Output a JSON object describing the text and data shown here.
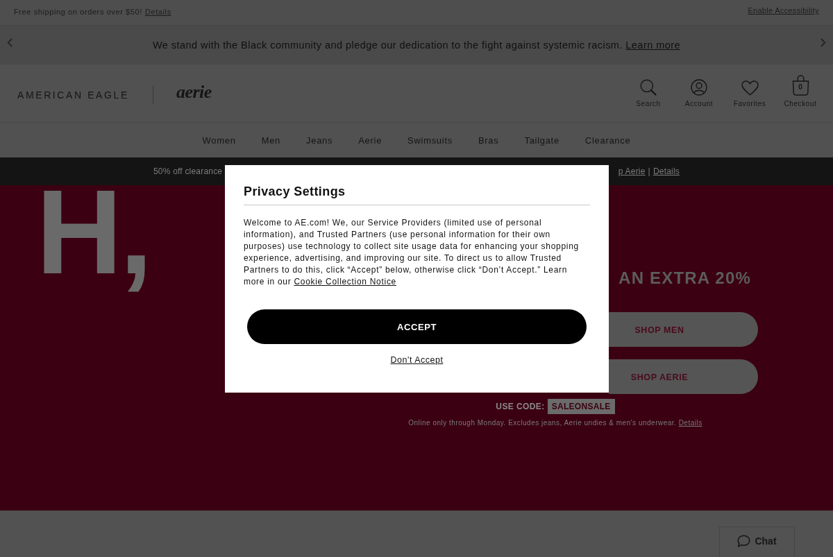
{
  "top_bar": {
    "shipping_text": "Free shipping on orders over $50!",
    "shipping_link": "Details",
    "accessibility_link": "Enable Accessibility"
  },
  "announcement": {
    "text": "We stand with the Black community and pledge our dedication to the fight against systemic racism.",
    "link": "Learn more"
  },
  "header": {
    "logos": [
      "AMERICAN EAGLE",
      "aerie"
    ],
    "actions": [
      {
        "kind": "search",
        "label": "Search"
      },
      {
        "kind": "account",
        "label": "Account"
      },
      {
        "kind": "favorites",
        "label": "Favorites"
      },
      {
        "kind": "bag",
        "label": "Checkout",
        "count": "0"
      }
    ]
  },
  "nav": [
    "Women",
    "Men",
    "Jeans",
    "Aerie",
    "Swimsuits",
    "Bras",
    "Tailgate",
    "Clearance"
  ],
  "promo_bar": {
    "left_text": "50% off clearance",
    "right_link": "p Aerie",
    "separator": "|",
    "details_link": "Details"
  },
  "hero": {
    "headline": "H,",
    "subheadline": "AN EXTRA 20%",
    "buttons": [
      "SHOP MEN",
      "SHOP AERIE"
    ],
    "code_label": "USE CODE:",
    "code": "SALEONSALE",
    "fine_print": "Online only through Monday. Excludes jeans, Aerie undies & men's underwear.",
    "fine_print_link": "Details"
  },
  "chat": {
    "label": "Chat"
  },
  "privacy_modal": {
    "title": "Privacy Settings",
    "body": "Welcome to AE.com! We, our Service Providers (limited use of personal information), and Trusted Partners (use personal information for their own purposes) use technology to collect site usage data for enhancing your shopping experience, advertising, and improving our site. To direct us to allow Trusted Partners to do this, click “Accept” below, otherwise click “Don’t Accept.” Learn more in our",
    "link": "Cookie Collection Notice",
    "accept": "ACCEPT",
    "decline": "Don't Accept"
  }
}
